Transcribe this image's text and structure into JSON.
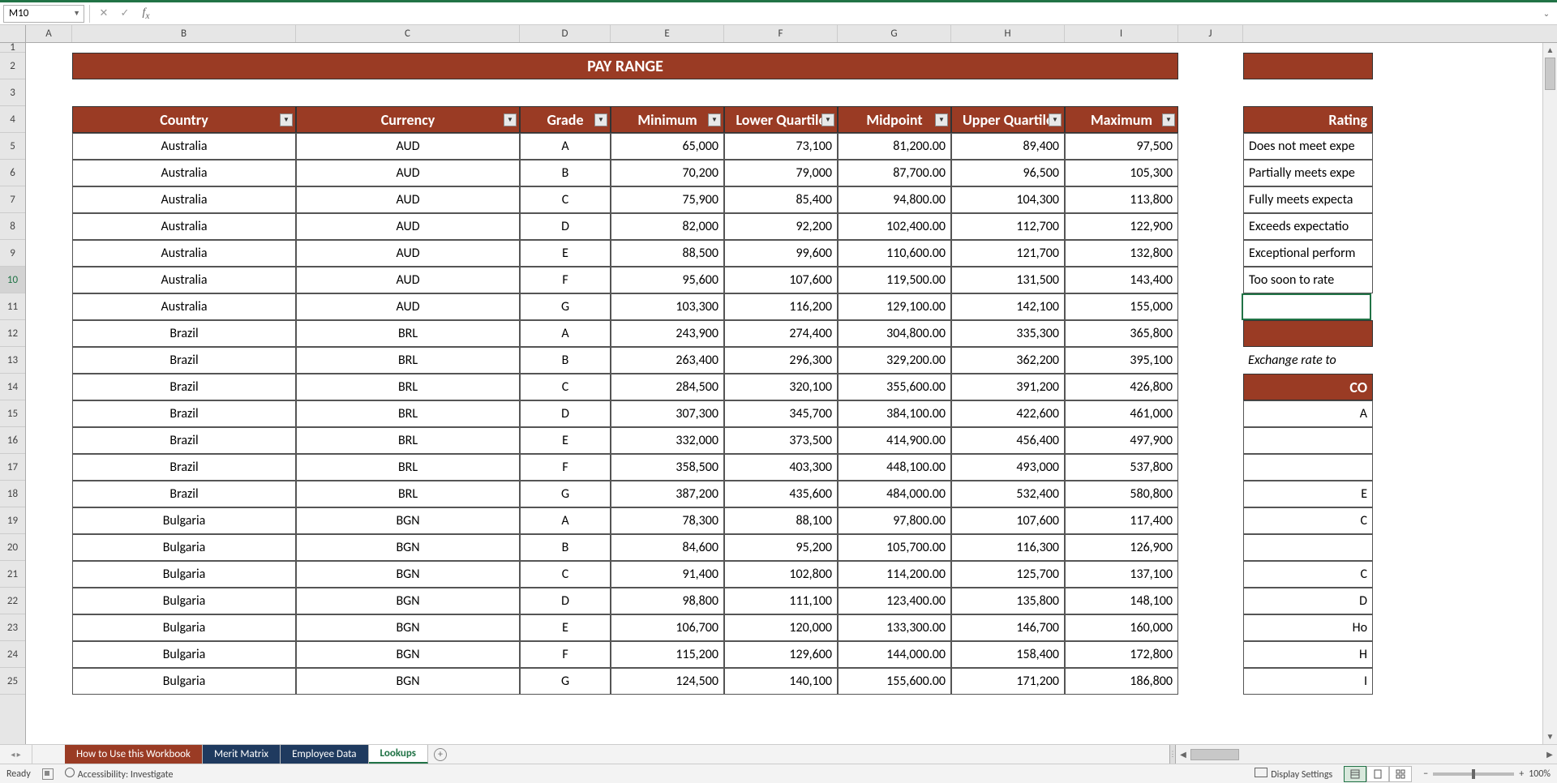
{
  "nameBox": "M10",
  "formula": "",
  "columns": [
    "A",
    "B",
    "C",
    "D",
    "E",
    "F",
    "G",
    "H",
    "I",
    "J"
  ],
  "rows": [
    "1",
    "2",
    "3",
    "4",
    "5",
    "6",
    "7",
    "8",
    "9",
    "10",
    "11",
    "12",
    "13",
    "14",
    "15",
    "16",
    "17",
    "18",
    "19",
    "20",
    "21",
    "22",
    "23",
    "24",
    "25"
  ],
  "title": "PAY RANGE",
  "headers": [
    "Country",
    "Currency",
    "Grade",
    "Minimum",
    "Lower Quartile",
    "Midpoint",
    "Upper Quartile",
    "Maximum"
  ],
  "data": [
    [
      "Australia",
      "AUD",
      "A",
      "65,000",
      "73,100",
      "81,200.00",
      "89,400",
      "97,500"
    ],
    [
      "Australia",
      "AUD",
      "B",
      "70,200",
      "79,000",
      "87,700.00",
      "96,500",
      "105,300"
    ],
    [
      "Australia",
      "AUD",
      "C",
      "75,900",
      "85,400",
      "94,800.00",
      "104,300",
      "113,800"
    ],
    [
      "Australia",
      "AUD",
      "D",
      "82,000",
      "92,200",
      "102,400.00",
      "112,700",
      "122,900"
    ],
    [
      "Australia",
      "AUD",
      "E",
      "88,500",
      "99,600",
      "110,600.00",
      "121,700",
      "132,800"
    ],
    [
      "Australia",
      "AUD",
      "F",
      "95,600",
      "107,600",
      "119,500.00",
      "131,500",
      "143,400"
    ],
    [
      "Australia",
      "AUD",
      "G",
      "103,300",
      "116,200",
      "129,100.00",
      "142,100",
      "155,000"
    ],
    [
      "Brazil",
      "BRL",
      "A",
      "243,900",
      "274,400",
      "304,800.00",
      "335,300",
      "365,800"
    ],
    [
      "Brazil",
      "BRL",
      "B",
      "263,400",
      "296,300",
      "329,200.00",
      "362,200",
      "395,100"
    ],
    [
      "Brazil",
      "BRL",
      "C",
      "284,500",
      "320,100",
      "355,600.00",
      "391,200",
      "426,800"
    ],
    [
      "Brazil",
      "BRL",
      "D",
      "307,300",
      "345,700",
      "384,100.00",
      "422,600",
      "461,000"
    ],
    [
      "Brazil",
      "BRL",
      "E",
      "332,000",
      "373,500",
      "414,900.00",
      "456,400",
      "497,900"
    ],
    [
      "Brazil",
      "BRL",
      "F",
      "358,500",
      "403,300",
      "448,100.00",
      "493,000",
      "537,800"
    ],
    [
      "Brazil",
      "BRL",
      "G",
      "387,200",
      "435,600",
      "484,000.00",
      "532,400",
      "580,800"
    ],
    [
      "Bulgaria",
      "BGN",
      "A",
      "78,300",
      "88,100",
      "97,800.00",
      "107,600",
      "117,400"
    ],
    [
      "Bulgaria",
      "BGN",
      "B",
      "84,600",
      "95,200",
      "105,700.00",
      "116,300",
      "126,900"
    ],
    [
      "Bulgaria",
      "BGN",
      "C",
      "91,400",
      "102,800",
      "114,200.00",
      "125,700",
      "137,100"
    ],
    [
      "Bulgaria",
      "BGN",
      "D",
      "98,800",
      "111,100",
      "123,400.00",
      "135,800",
      "148,100"
    ],
    [
      "Bulgaria",
      "BGN",
      "E",
      "106,700",
      "120,000",
      "133,300.00",
      "146,700",
      "160,000"
    ],
    [
      "Bulgaria",
      "BGN",
      "F",
      "115,200",
      "129,600",
      "144,000.00",
      "158,400",
      "172,800"
    ],
    [
      "Bulgaria",
      "BGN",
      "G",
      "124,500",
      "140,100",
      "155,600.00",
      "171,200",
      "186,800"
    ]
  ],
  "sideHeader1": "Rating",
  "sideRatings": [
    "Does not meet expe",
    "Partially meets expe",
    "Fully meets expecta",
    "Exceeds expectatio",
    "Exceptional perform",
    "Too soon to rate"
  ],
  "sideNote": "Exchange rate to",
  "sideHeader2": "CO",
  "sideCol": [
    "A",
    "",
    "",
    "E",
    "C",
    "",
    "C",
    "D",
    "Ho",
    "H",
    "I",
    ""
  ],
  "tabs": {
    "t1": "How to Use this Workbook",
    "t2": "Merit Matrix",
    "t3": "Employee Data",
    "t4": "Lookups"
  },
  "status": {
    "ready": "Ready",
    "accessibility": "Accessibility: Investigate",
    "display": "Display Settings",
    "zoom": "100%"
  }
}
